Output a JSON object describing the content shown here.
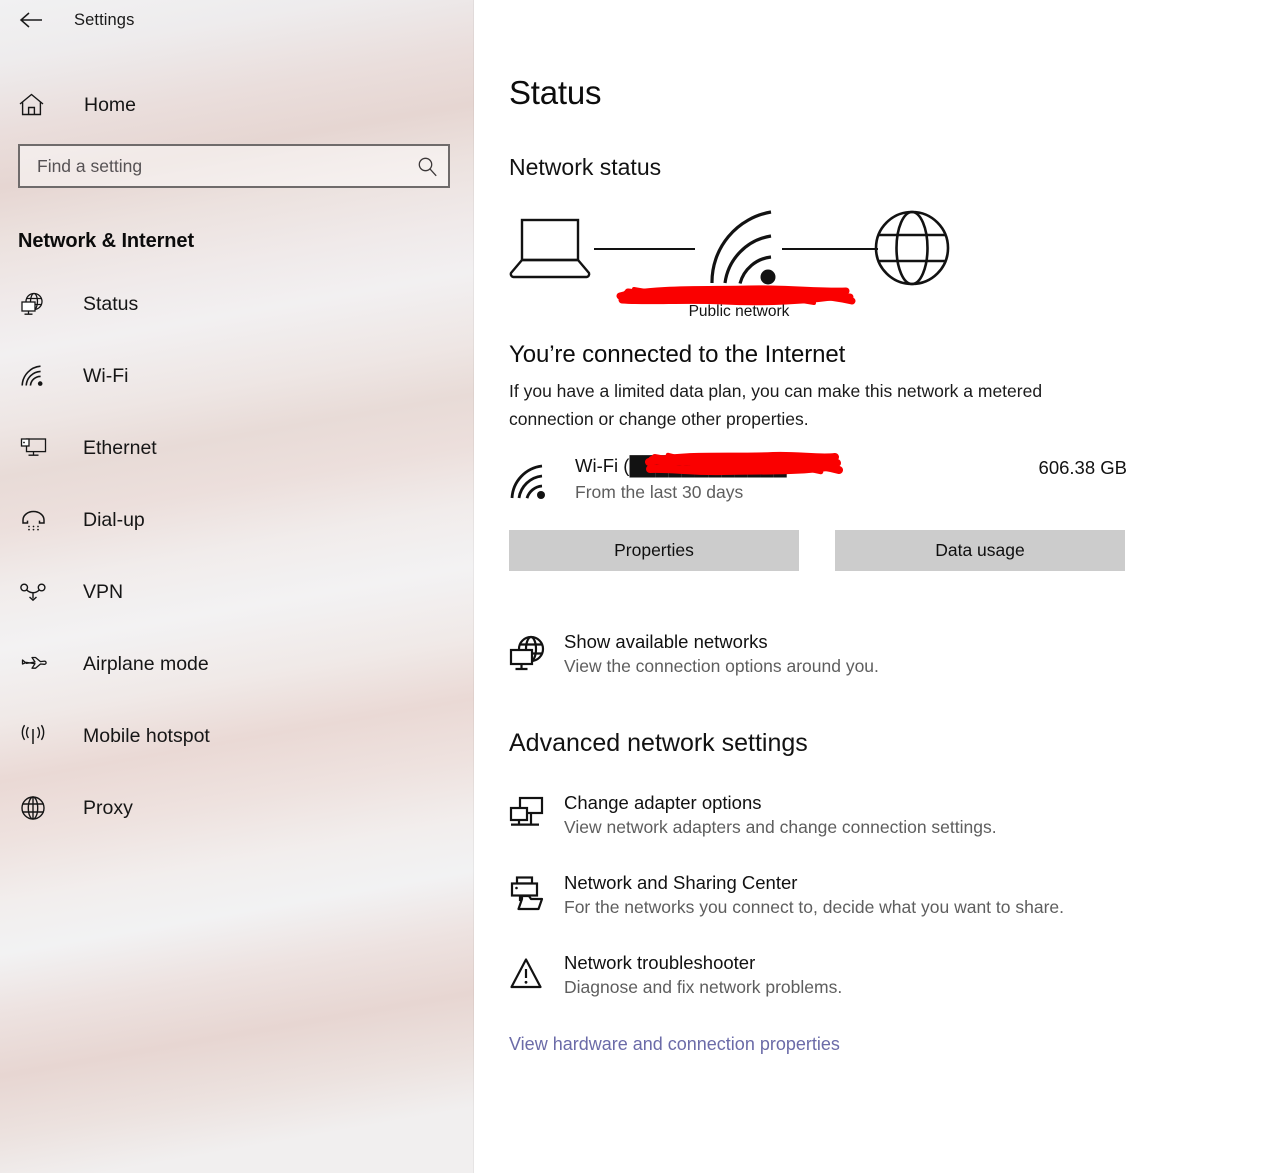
{
  "titlebar": {
    "back_label": "Back",
    "title": "Settings"
  },
  "sidebar": {
    "home": {
      "label": "Home",
      "icon": "home-icon"
    },
    "search": {
      "placeholder": "Find a setting",
      "value": "",
      "icon": "search-icon"
    },
    "category": "Network & Internet",
    "items": [
      {
        "label": "Status",
        "icon": "globe-monitor-icon",
        "selected": true
      },
      {
        "label": "Wi-Fi",
        "icon": "wifi-icon",
        "selected": false
      },
      {
        "label": "Ethernet",
        "icon": "ethernet-icon",
        "selected": false
      },
      {
        "label": "Dial-up",
        "icon": "dialup-icon",
        "selected": false
      },
      {
        "label": "VPN",
        "icon": "vpn-icon",
        "selected": false
      },
      {
        "label": "Airplane mode",
        "icon": "airplane-icon",
        "selected": false
      },
      {
        "label": "Mobile hotspot",
        "icon": "hotspot-icon",
        "selected": false
      },
      {
        "label": "Proxy",
        "icon": "globe-icon",
        "selected": false
      }
    ]
  },
  "main": {
    "page_title": "Status",
    "network_status_heading": "Network status",
    "diagram": {
      "device_icon": "laptop-icon",
      "link_icon": "wifi-signal-icon",
      "internet_icon": "globe-icon",
      "network_name_redacted": true,
      "network_type_label": "Public network"
    },
    "connection": {
      "title": "You’re connected to the Internet",
      "description": "If you have a limited data plan, you can make this network a metered connection or change other properties.",
      "adapter_icon": "wifi-icon",
      "adapter_name_prefix": "Wi-Fi (",
      "adapter_name_redacted": true,
      "adapter_name_suffix": "...",
      "adapter_name_full": "Wi-Fi (████████████...",
      "period": "From the last 30 days",
      "data_used": "606.38 GB"
    },
    "buttons": {
      "properties": "Properties",
      "data_usage": "Data usage"
    },
    "show_networks": {
      "icon": "globe-monitor-icon",
      "title": "Show available networks",
      "subtitle": "View the connection options around you."
    },
    "advanced_heading": "Advanced network settings",
    "advanced_items": [
      {
        "icon": "adapter-icon",
        "title": "Change adapter options",
        "subtitle": "View network adapters and change connection settings."
      },
      {
        "icon": "sharing-icon",
        "title": "Network and Sharing Center",
        "subtitle": "For the networks you connect to, decide what you want to share."
      },
      {
        "icon": "warning-triangle-icon",
        "title": "Network troubleshooter",
        "subtitle": "Diagnose and fix network problems."
      }
    ],
    "footer_link": "View hardware and connection properties"
  },
  "colors": {
    "redaction": "#fa0000",
    "button_bg": "#cccccc",
    "link": "#6b6ba8",
    "text_primary": "#121212",
    "text_secondary": "#5e5e5e",
    "search_border": "#6f6b6b"
  }
}
